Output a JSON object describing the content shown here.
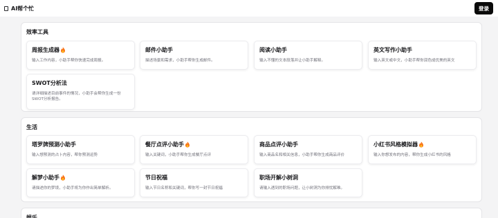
{
  "app": {
    "title": "AI帮个忙",
    "login_label": "登录"
  },
  "sections": [
    {
      "title": "效率工具",
      "cards": [
        {
          "title": "周报生成器",
          "hot": true,
          "desc": "输入工作内容，小助手帮你快速完成周报。"
        },
        {
          "title": "邮件小助手",
          "hot": false,
          "desc": "描述场景和需求，小助手帮你生成邮件。"
        },
        {
          "title": "阅读小助手",
          "hot": false,
          "desc": "输入不懂的文本段落并让小助手解释。"
        },
        {
          "title": "英文写作小助手",
          "hot": false,
          "desc": "输入英文或中文，小助手帮你润色成优美的英文"
        },
        {
          "title": "SWOT分析法",
          "hot": false,
          "desc": "请详细描述目前事件的情况，小助手会帮你生成一份SWOT分析报告。"
        }
      ]
    },
    {
      "title": "生活",
      "cards": [
        {
          "title": "塔罗牌预测小助手",
          "hot": false,
          "desc": "输入想预测的占卜内容，帮你预测运势"
        },
        {
          "title": "餐厅点评小助手",
          "hot": true,
          "desc": "输入关键词，小助手帮你生成餐厅点评"
        },
        {
          "title": "商品点评小助手",
          "hot": false,
          "desc": "输入商品名和相关信息，小助手帮你生成商品评价"
        },
        {
          "title": "小红书风格模拟器",
          "hot": true,
          "desc": "输入你想发布的内容，帮你生成小红书的风格"
        },
        {
          "title": "解梦小助手",
          "hot": true,
          "desc": "请描述你的梦境，小助手将为你作出简单解析。"
        },
        {
          "title": "节日祝福",
          "hot": false,
          "desc": "输入节日名称和关键词，帮你写一封节日祝福"
        },
        {
          "title": "职场开解小树洞",
          "hot": false,
          "desc": "请输入遇到的职场问题，让小树洞为你排忧解难。"
        }
      ]
    },
    {
      "title": "娱乐",
      "cards": []
    }
  ],
  "colors": {
    "accent": "#0a0a0a",
    "fire": "#f97316"
  },
  "icons": {
    "brand": "robot-icon",
    "hot": "fire-icon"
  }
}
